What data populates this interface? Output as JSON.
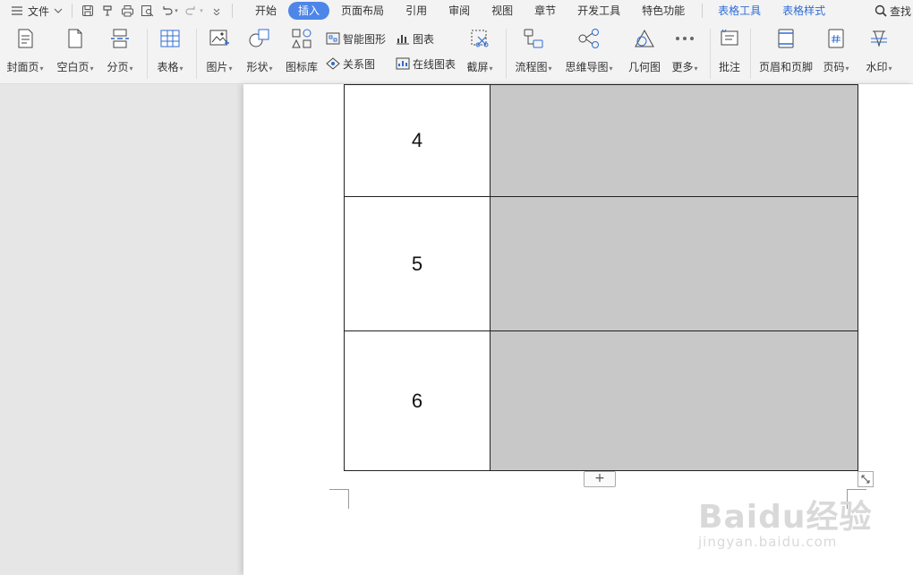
{
  "menubar": {
    "menu_label": "文件",
    "tabs": [
      "开始",
      "插入",
      "页面布局",
      "引用",
      "审阅",
      "视图",
      "章节",
      "开发工具",
      "特色功能"
    ],
    "active_tab": "插入",
    "context_tabs": [
      "表格工具",
      "表格样式"
    ],
    "search_label": "查找"
  },
  "ribbon": {
    "buttons": [
      {
        "label": "封面页",
        "dropdown": true,
        "icon": "cover-page-icon"
      },
      {
        "label": "空白页",
        "dropdown": true,
        "icon": "blank-page-icon"
      },
      {
        "label": "分页",
        "dropdown": true,
        "icon": "page-break-icon"
      },
      {
        "label": "表格",
        "dropdown": true,
        "icon": "table-icon"
      },
      {
        "label": "图片",
        "dropdown": true,
        "icon": "picture-icon"
      },
      {
        "label": "形状",
        "dropdown": true,
        "icon": "shapes-icon"
      },
      {
        "label": "图标库",
        "dropdown": false,
        "icon": "icon-library-icon"
      },
      {
        "label": "截屏",
        "dropdown": true,
        "icon": "screenshot-icon"
      },
      {
        "label": "流程图",
        "dropdown": true,
        "icon": "flowchart-icon"
      },
      {
        "label": "思维导图",
        "dropdown": true,
        "icon": "mindmap-icon"
      },
      {
        "label": "几何图",
        "dropdown": false,
        "icon": "geometry-icon"
      },
      {
        "label": "更多",
        "dropdown": true,
        "icon": "more-icon"
      },
      {
        "label": "批注",
        "dropdown": false,
        "icon": "comment-icon"
      },
      {
        "label": "页眉和页脚",
        "dropdown": false,
        "icon": "header-footer-icon"
      },
      {
        "label": "页码",
        "dropdown": true,
        "icon": "page-number-icon"
      },
      {
        "label": "水印",
        "dropdown": true,
        "icon": "watermark-icon"
      }
    ],
    "small_buttons": {
      "smartart": "智能图形",
      "chart": "图表",
      "relation": "关系图",
      "online_chart": "在线图表"
    }
  },
  "table": {
    "rows": [
      "4",
      "5",
      "6"
    ],
    "shaded_color": "#c8c8c8"
  },
  "watermark": {
    "main": "Baidu经验",
    "sub": "jingyan.baidu.com"
  },
  "colors": {
    "accent": "#4d86e8",
    "context_tab": "#2f6cd6"
  }
}
